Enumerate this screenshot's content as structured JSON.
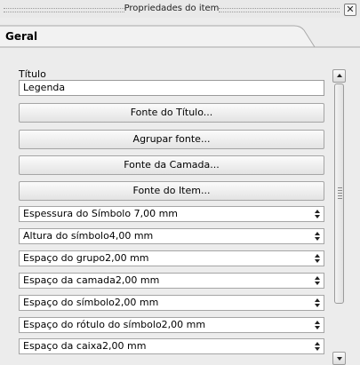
{
  "window": {
    "title": "Propriedades do item",
    "close_symbol": "✕"
  },
  "tab": {
    "label": "Geral"
  },
  "title_section": {
    "label": "Título",
    "value": "Legenda"
  },
  "buttons": [
    {
      "label": "Fonte do Título..."
    },
    {
      "label": "Agrupar fonte..."
    },
    {
      "label": "Fonte da Camada..."
    },
    {
      "label": "Fonte do Item..."
    }
  ],
  "spinboxes": [
    {
      "label": "Espessura do Símbolo 7,00 mm"
    },
    {
      "label": "Altura do símbolo4,00 mm"
    },
    {
      "label": "Espaço do grupo2,00 mm"
    },
    {
      "label": "Espaço da camada2,00 mm"
    },
    {
      "label": "Espaço do símbolo2,00 mm"
    },
    {
      "label": "Espaço do rótulo do símbolo2,00 mm"
    },
    {
      "label": "Espaço da caixa2,00 mm"
    }
  ]
}
